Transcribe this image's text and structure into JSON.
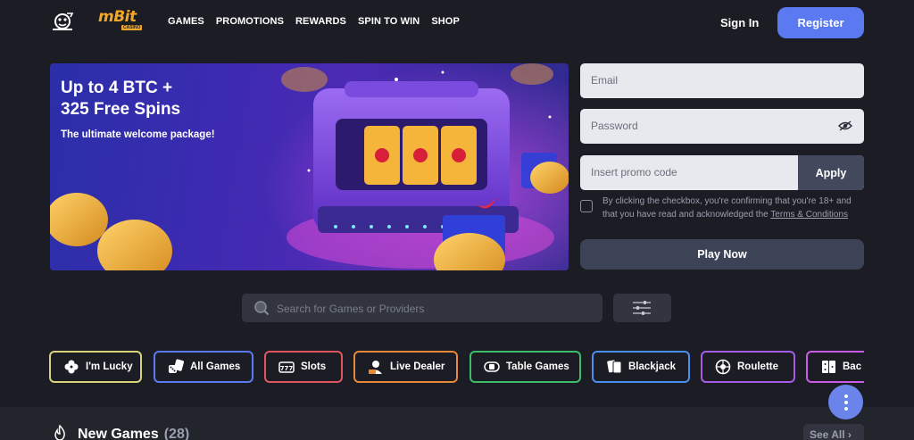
{
  "header": {
    "logo": "mBit",
    "logo_sub": "CASINO",
    "nav": [
      "GAMES",
      "PROMOTIONS",
      "REWARDS",
      "SPIN TO WIN",
      "SHOP"
    ],
    "signin_label": "Sign In",
    "register_label": "Register"
  },
  "banner": {
    "title": "Up to 4 BTC +\n325 Free Spins",
    "subtitle": "The ultimate welcome package!"
  },
  "form": {
    "email_placeholder": "Email",
    "password_placeholder": "Password",
    "promo_placeholder": "Insert promo code",
    "apply_label": "Apply",
    "consent_text": "By clicking the checkbox, you're confirming that you're 18+ and that you have read and acknowledged the ",
    "terms_link": "Terms & Conditions",
    "checkbox_checked": false,
    "play_label": "Play Now"
  },
  "search": {
    "placeholder": "Search for Games or Providers"
  },
  "categories": [
    {
      "label": "I'm Lucky",
      "icon": "clover-icon",
      "color": "#d8d27a"
    },
    {
      "label": "All Games",
      "icon": "dice-cards-icon",
      "color": "#5b79f0"
    },
    {
      "label": "Slots",
      "icon": "slot-777-icon",
      "color": "#e0565f"
    },
    {
      "label": "Live Dealer",
      "icon": "live-dealer-icon",
      "color": "#e8893a"
    },
    {
      "label": "Table Games",
      "icon": "table-games-icon",
      "color": "#3dbd6a"
    },
    {
      "label": "Blackjack",
      "icon": "cards-icon",
      "color": "#4a8ff0"
    },
    {
      "label": "Roulette",
      "icon": "roulette-icon",
      "color": "#a65ce6"
    },
    {
      "label": "Bac",
      "icon": "baccarat-icon",
      "color": "#c85ce6"
    }
  ],
  "section": {
    "title": "New Games",
    "count": "(28)",
    "see_all": "See All"
  }
}
